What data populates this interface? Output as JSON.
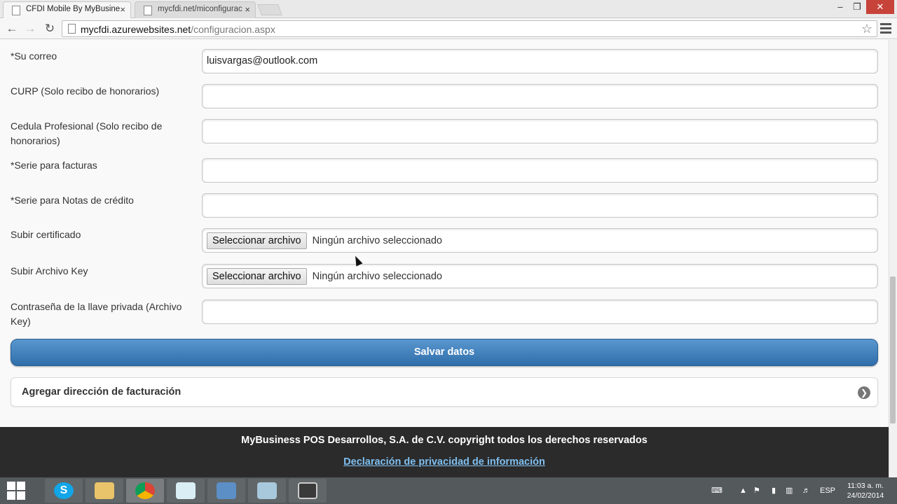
{
  "browser": {
    "tabs": [
      {
        "title": "CFDI Mobile By MyBusine",
        "close": "×",
        "active": true
      },
      {
        "title": "mycfdi.net/miconfigurac",
        "close": "×",
        "active": false
      }
    ],
    "url_host": "mycfdi.azurewebsites.net",
    "url_path": "/configuracion.aspx",
    "window_buttons": {
      "minimize": "–",
      "restore": "❐",
      "close": "✕"
    }
  },
  "form": {
    "rows": [
      {
        "label": "*Su correo",
        "value": ""
      },
      {
        "label": "CURP (Solo recibo de honorarios)",
        "value": ""
      },
      {
        "label": "Cedula Profesional (Solo recibo de honorarios)",
        "value": ""
      },
      {
        "label": "*Serie para facturas",
        "value": ""
      },
      {
        "label": "*Serie para Notas de crédito",
        "value": ""
      },
      {
        "label": "Subir certificado",
        "button": "Seleccionar archivo",
        "status": "Ningún archivo seleccionado"
      },
      {
        "label": "Subir Archivo Key",
        "button": "Seleccionar archivo",
        "status": "Ningún archivo seleccionado"
      },
      {
        "label": "Contraseña de la llave privada (Archivo Key)",
        "value": ""
      }
    ],
    "email_value": "luisvargas@outlook.com",
    "save_label": "Salvar datos",
    "collapsible_title": "Agregar dirección de facturación"
  },
  "footer": {
    "copyright": "MyBusiness POS Desarrollos, S.A. de C.V. copyright todos los derechos reservados",
    "privacy_link": "Declaración de privacidad de información"
  },
  "taskbar": {
    "apps": [
      "skype-icon",
      "file-explorer-icon",
      "chrome-icon",
      "app-icon",
      "remote-desktop-icon",
      "notes-icon",
      "solitaire-icon"
    ],
    "language": "ESP",
    "time": "11:03 a. m.",
    "date": "24/02/2014"
  },
  "colors": {
    "save_button": "#3d7fbd",
    "footer_bg": "#2b2b2b",
    "link": "#7fbff0",
    "taskbar": "#54595c"
  }
}
